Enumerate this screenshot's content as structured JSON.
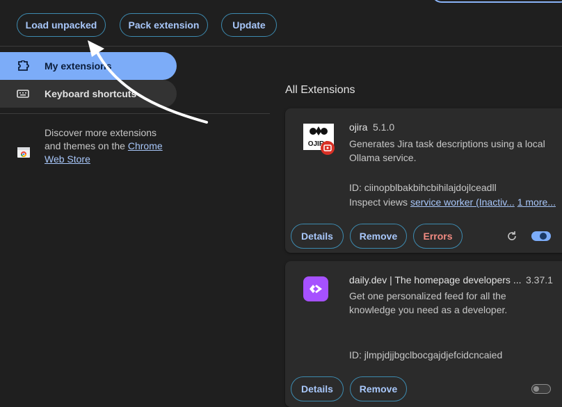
{
  "toolbar": {
    "load_unpacked": "Load unpacked",
    "pack_extension": "Pack extension",
    "update": "Update"
  },
  "sidebar": {
    "items": [
      {
        "label": "My extensions",
        "icon": "puzzle-icon",
        "selected": true
      },
      {
        "label": "Keyboard shortcuts",
        "icon": "keyboard-icon",
        "selected": false
      }
    ],
    "discover": {
      "text": "Discover more extensions and themes on the ",
      "link": "Chrome Web Store"
    }
  },
  "main": {
    "section_title": "All Extensions",
    "extensions": [
      {
        "name": "ojira",
        "version": "5.1.0",
        "description": "Generates Jira task descriptions using a local Ollama service.",
        "id": "ID: ciinopblbakbihcbihilajdojlceadll",
        "inspect_label": "Inspect views",
        "inspect_link": "service worker (Inactiv...",
        "inspect_more": "1 more...",
        "buttons": {
          "details": "Details",
          "remove": "Remove",
          "errors": "Errors"
        },
        "enabled": true,
        "logo_text": "OJIRA"
      },
      {
        "name": "daily.dev | The homepage developers ...",
        "version": "3.37.1",
        "description": "Get one personalized feed for all the knowledge you need as a developer.",
        "id": "ID: jlmpjdjjbgclbocgajdjefcidcncaied",
        "buttons": {
          "details": "Details",
          "remove": "Remove"
        },
        "enabled": false
      }
    ]
  },
  "colors": {
    "background": "#1f1f1f",
    "accent": "#a8c7fa",
    "selected_nav": "#7cacf8",
    "error": "#f28b82",
    "card": "#2b2b2b",
    "daily_dev": "#a651ff"
  }
}
